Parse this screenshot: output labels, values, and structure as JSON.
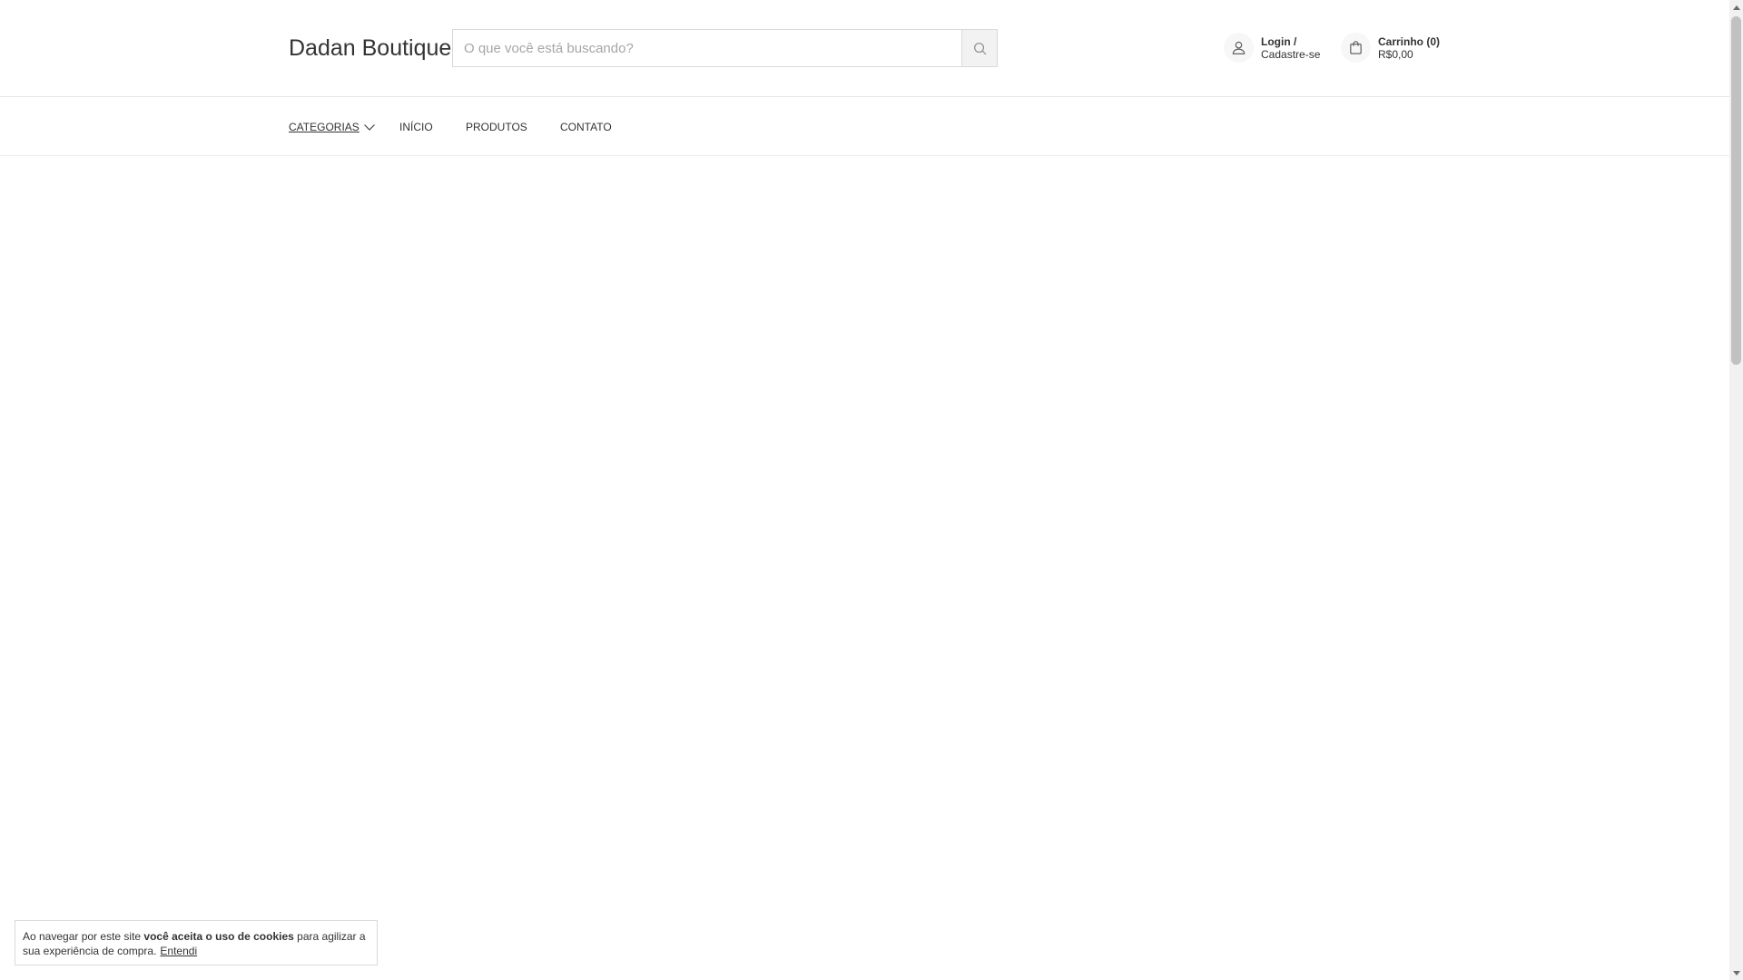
{
  "header": {
    "logo": "Dadan Boutique",
    "search": {
      "placeholder": "O que você está buscando?",
      "value": ""
    },
    "account": {
      "line1": "Login /",
      "line2": "Cadastre-se"
    },
    "cart": {
      "label": "Carrinho (0)",
      "total": "R$0,00"
    }
  },
  "nav": {
    "items": [
      {
        "label": "CATEGORIAS"
      },
      {
        "label": "INÍCIO"
      },
      {
        "label": "PRODUTOS"
      },
      {
        "label": "CONTATO"
      }
    ]
  },
  "cookie": {
    "text_before": "Ao navegar por este site ",
    "text_bold": "você aceita o uso de cookies",
    "text_after": " para agilizar a sua experiência de compra.",
    "accept_label": "Entendi"
  }
}
